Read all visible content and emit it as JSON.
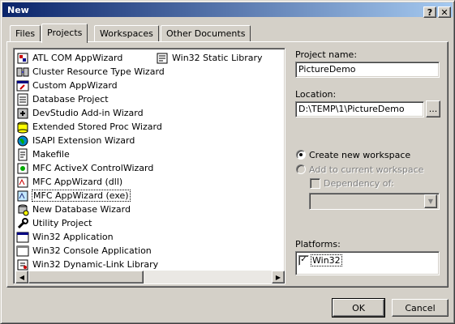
{
  "window": {
    "title": "New",
    "help_button": "?",
    "close_button": "✕"
  },
  "tabs": [
    {
      "label": "Files",
      "active": false
    },
    {
      "label": "Projects",
      "active": true
    },
    {
      "label": "Workspaces",
      "active": false
    },
    {
      "label": "Other Documents",
      "active": false
    }
  ],
  "project_types": {
    "column1": [
      {
        "label": "ATL COM AppWizard",
        "icon": "atl-com-icon"
      },
      {
        "label": "Cluster Resource Type Wizard",
        "icon": "cluster-icon"
      },
      {
        "label": "Custom AppWizard",
        "icon": "custom-appwizard-icon"
      },
      {
        "label": "Database Project",
        "icon": "database-icon"
      },
      {
        "label": "DevStudio Add-in Wizard",
        "icon": "addin-icon"
      },
      {
        "label": "Extended Stored Proc Wizard",
        "icon": "stored-proc-icon"
      },
      {
        "label": "ISAPI Extension Wizard",
        "icon": "globe-icon"
      },
      {
        "label": "Makefile",
        "icon": "makefile-icon"
      },
      {
        "label": "MFC ActiveX ControlWizard",
        "icon": "activex-icon"
      },
      {
        "label": "MFC AppWizard (dll)",
        "icon": "mfc-dll-icon"
      },
      {
        "label": "MFC AppWizard (exe)",
        "icon": "mfc-exe-icon",
        "selected": true
      },
      {
        "label": "New Database Wizard",
        "icon": "new-database-icon"
      },
      {
        "label": "Utility Project",
        "icon": "utility-icon"
      },
      {
        "label": "Win32 Application",
        "icon": "win32-app-icon"
      },
      {
        "label": "Win32 Console Application",
        "icon": "console-icon"
      },
      {
        "label": "Win32 Dynamic-Link Library",
        "icon": "dll-icon"
      }
    ],
    "column2": [
      {
        "label": "Win32 Static Library",
        "icon": "static-lib-icon"
      }
    ]
  },
  "project_name": {
    "label": "Project name:",
    "value": "PictureDemo"
  },
  "location": {
    "label": "Location:",
    "value": "D:\\TEMP\\1\\PictureDemo",
    "browse_label": "..."
  },
  "workspace_options": {
    "create_new": {
      "label": "Create new workspace",
      "checked": true
    },
    "add_to_current": {
      "label": "Add to current workspace",
      "checked": false,
      "disabled": true
    },
    "dependency_of": {
      "label": "Dependency of:",
      "checked": false,
      "disabled": true
    },
    "dependency_value": ""
  },
  "platforms": {
    "label": "Platforms:",
    "items": [
      {
        "label": "Win32",
        "checked": true
      }
    ]
  },
  "buttons": {
    "ok": "OK",
    "cancel": "Cancel"
  }
}
